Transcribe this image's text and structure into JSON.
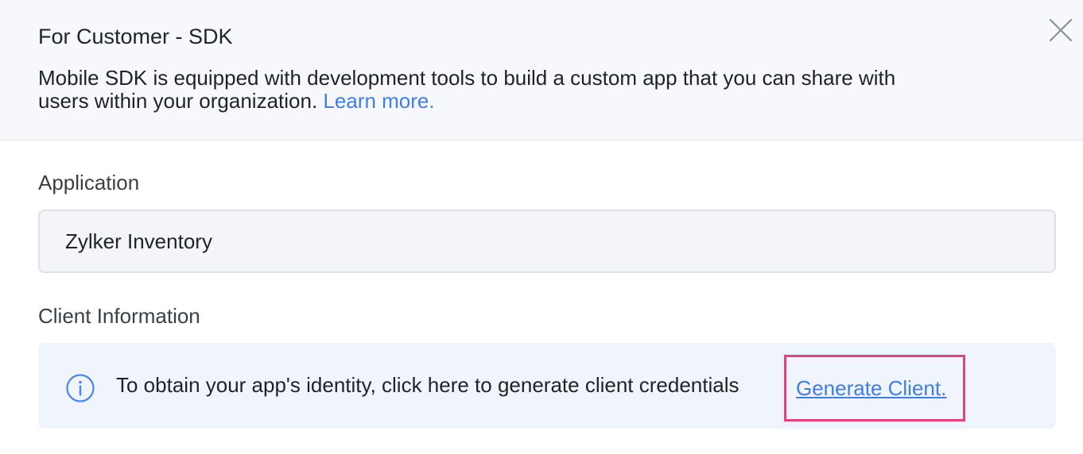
{
  "dialog": {
    "title": "For Customer - SDK",
    "description": "Mobile SDK is equipped with development tools to build a custom app that you can share with users within your organization.",
    "learn_more": "Learn more."
  },
  "application": {
    "label": "Application",
    "value": "Zylker Inventory"
  },
  "client_information": {
    "label": "Client Information",
    "info_text": "To obtain your app's identity, click here to generate client credentials",
    "generate_link": "Generate Client."
  },
  "colors": {
    "link": "#3f7ee8",
    "highlight_border": "#e8417a",
    "info_background": "#f0f4fd",
    "header_background": "#f7f8fb"
  },
  "icons": {
    "close": "close-icon",
    "info": "info-icon"
  }
}
